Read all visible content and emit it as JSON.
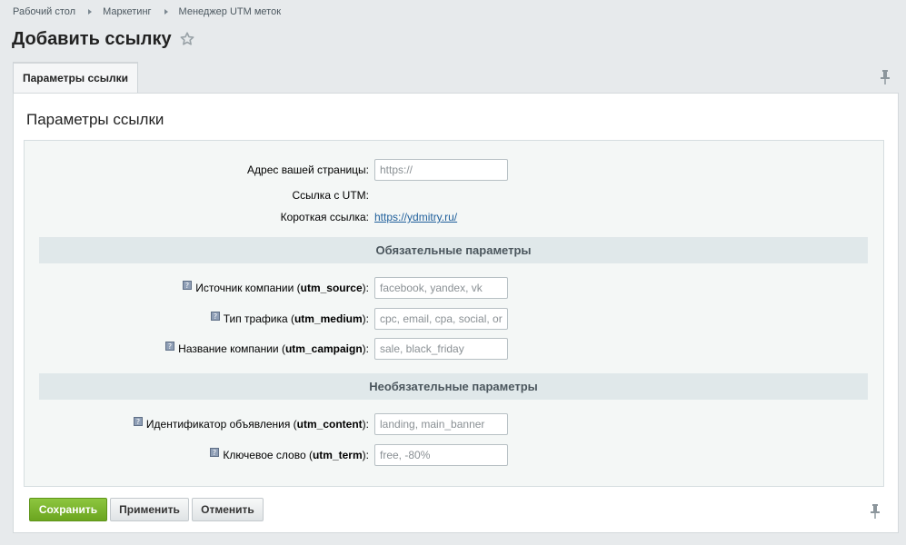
{
  "breadcrumb": [
    "Рабочий стол",
    "Маркетинг",
    "Менеджер UTM меток"
  ],
  "page_title": "Добавить ссылку",
  "tab": {
    "label": "Параметры ссылки"
  },
  "panel_title": "Параметры ссылки",
  "fields": {
    "page_address": {
      "label": "Адрес вашей страницы:",
      "placeholder": "https://"
    },
    "utm_link": {
      "label": "Ссылка с UTM:"
    },
    "short_link": {
      "label": "Короткая ссылка:",
      "value": "https://ydmitry.ru/"
    }
  },
  "sections": {
    "required": "Обязательные параметры",
    "optional": "Необязательные параметры"
  },
  "params": {
    "utm_source": {
      "label_prefix": "Источник компании (",
      "code": "utm_source",
      "label_suffix": "):",
      "placeholder": "facebook, yandex, vk"
    },
    "utm_medium": {
      "label_prefix": "Тип трафика (",
      "code": "utm_medium",
      "label_suffix": "):",
      "placeholder": "cpc, email, cpa, social, organic"
    },
    "utm_campaign": {
      "label_prefix": "Название компании (",
      "code": "utm_campaign",
      "label_suffix": "):",
      "placeholder": "sale, black_friday"
    },
    "utm_content": {
      "label_prefix": "Идентификатор объявления (",
      "code": "utm_content",
      "label_suffix": "):",
      "placeholder": "landing, main_banner"
    },
    "utm_term": {
      "label_prefix": "Ключевое слово (",
      "code": "utm_term",
      "label_suffix": "):",
      "placeholder": "free, -80%"
    }
  },
  "buttons": {
    "save": "Сохранить",
    "apply": "Применить",
    "cancel": "Отменить"
  },
  "colors": {
    "save_button": "#7cb82f",
    "link": "#1f5f9b",
    "section_bar": "#e0e8ea"
  }
}
